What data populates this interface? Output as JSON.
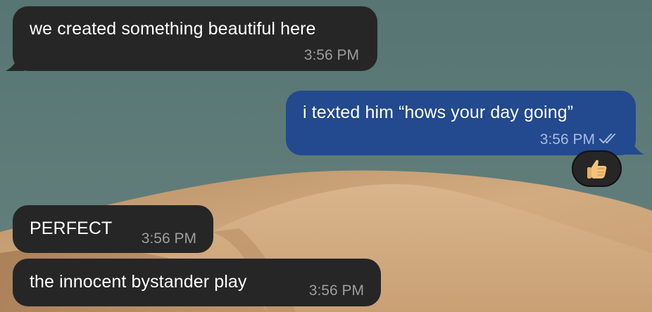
{
  "conversation": {
    "messages": [
      {
        "direction": "incoming",
        "text": "we created something beautiful here",
        "time": "3:56 PM"
      },
      {
        "direction": "outgoing",
        "text": "i texted him “hows your day going”",
        "time": "3:56 PM",
        "status": "read",
        "status_icon": "double-check-icon",
        "reaction": "👍🏼"
      },
      {
        "direction": "incoming",
        "text": "PERFECT",
        "time": "3:56 PM"
      },
      {
        "direction": "incoming",
        "text": "the innocent bystander play",
        "time": "3:56 PM"
      }
    ]
  },
  "colors": {
    "background_sky": "#5d7b79",
    "dune": "#c49a6c",
    "incoming_bubble": "#262626",
    "outgoing_bubble": "#23498f",
    "text": "#ffffff",
    "incoming_time": "#9d9d9d",
    "outgoing_time": "#a8bbe0"
  }
}
